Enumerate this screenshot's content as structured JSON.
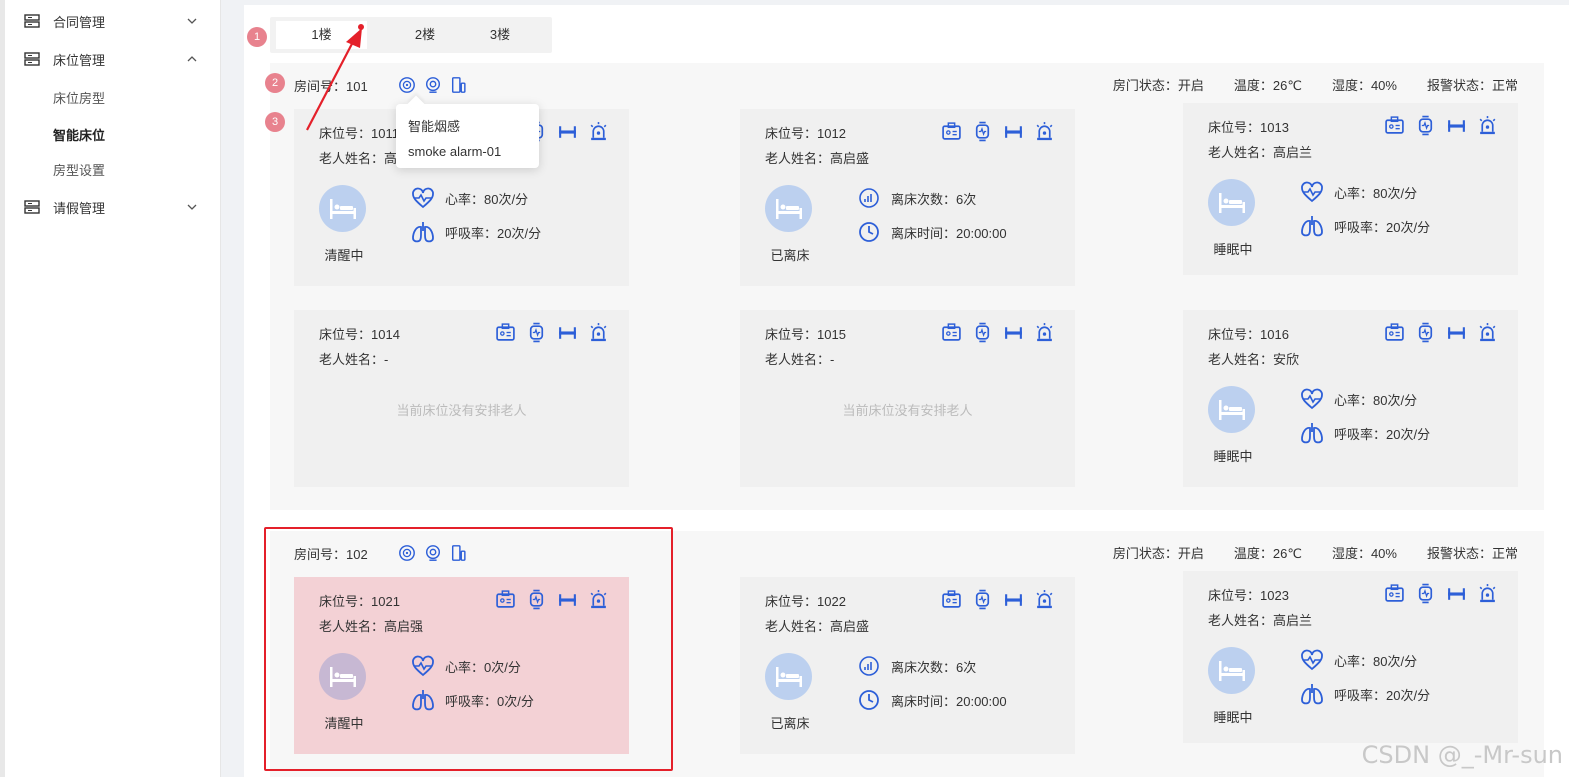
{
  "sidebar": {
    "items": [
      {
        "label": "合同管理",
        "expanded": false
      },
      {
        "label": "床位管理",
        "expanded": true
      },
      {
        "label": "请假管理",
        "expanded": false
      }
    ],
    "sub_items": [
      {
        "label": "床位房型"
      },
      {
        "label": "智能床位",
        "active": true
      },
      {
        "label": "房型设置"
      }
    ]
  },
  "floor_tabs": [
    {
      "label": "1楼",
      "active": true
    },
    {
      "label": "2楼"
    },
    {
      "label": "3楼"
    }
  ],
  "badges": [
    "1",
    "2",
    "3"
  ],
  "tooltip": {
    "title": "智能烟感",
    "device": "smoke alarm-01"
  },
  "rooms": [
    {
      "room_label": "房间号：101",
      "door": "房门状态：开启",
      "temp": "温度：26℃",
      "humidity": "湿度：40%",
      "alarm": "报警状态：正常",
      "beds": [
        {
          "bed": "床位号：1011",
          "elder": "老人姓名：高启强",
          "state": "清醒中",
          "m1": "心率：80次/分",
          "m2": "呼吸率：20次/分",
          "kind": "vital"
        },
        {
          "bed": "床位号：1012",
          "elder": "老人姓名：高启盛",
          "state": "已离床",
          "m1": "离床次数：6次",
          "m2": "离床时间：20:00:00",
          "kind": "away"
        },
        {
          "bed": "床位号：1013",
          "elder": "老人姓名：高启兰",
          "state": "睡眠中",
          "m1": "心率：80次/分",
          "m2": "呼吸率：20次/分",
          "kind": "vital"
        },
        {
          "bed": "床位号：1014",
          "elder": "老人姓名：-",
          "empty": "当前床位没有安排老人",
          "kind": "empty"
        },
        {
          "bed": "床位号：1015",
          "elder": "老人姓名：-",
          "empty": "当前床位没有安排老人",
          "kind": "empty"
        },
        {
          "bed": "床位号：1016",
          "elder": "老人姓名：安欣",
          "state": "睡眠中",
          "m1": "心率：80次/分",
          "m2": "呼吸率：20次/分",
          "kind": "vital"
        }
      ]
    },
    {
      "room_label": "房间号：102",
      "door": "房门状态：开启",
      "temp": "温度：26℃",
      "humidity": "湿度：40%",
      "alarm": "报警状态：正常",
      "beds": [
        {
          "bed": "床位号：1021",
          "elder": "老人姓名：高启强",
          "state": "清醒中",
          "m1": "心率：0次/分",
          "m2": "呼吸率：0次/分",
          "kind": "vital",
          "alarm": true
        },
        {
          "bed": "床位号：1022",
          "elder": "老人姓名：高启盛",
          "state": "已离床",
          "m1": "离床次数：6次",
          "m2": "离床时间：20:00:00",
          "kind": "away"
        },
        {
          "bed": "床位号：1023",
          "elder": "老人姓名：高启兰",
          "state": "睡眠中",
          "m1": "心率：80次/分",
          "m2": "呼吸率：20次/分",
          "kind": "vital"
        }
      ]
    }
  ],
  "icons": {
    "room": [
      "smoke-detector-icon",
      "camera-sensor-icon",
      "gateway-icon"
    ],
    "bed": [
      "id-card-icon",
      "smartwatch-icon",
      "bed-icon",
      "alarm-light-icon"
    ],
    "vital": [
      "heart-rate-icon",
      "lungs-icon"
    ],
    "away": [
      "bar-chart-icon",
      "clock-icon"
    ]
  },
  "colors": {
    "accent": "#2d5fd8",
    "alarm_bg": "#f3d1d5",
    "badge": "#e8828e",
    "highlight_border": "#e4202a"
  },
  "watermark": "CSDN @_-Mr-sun"
}
